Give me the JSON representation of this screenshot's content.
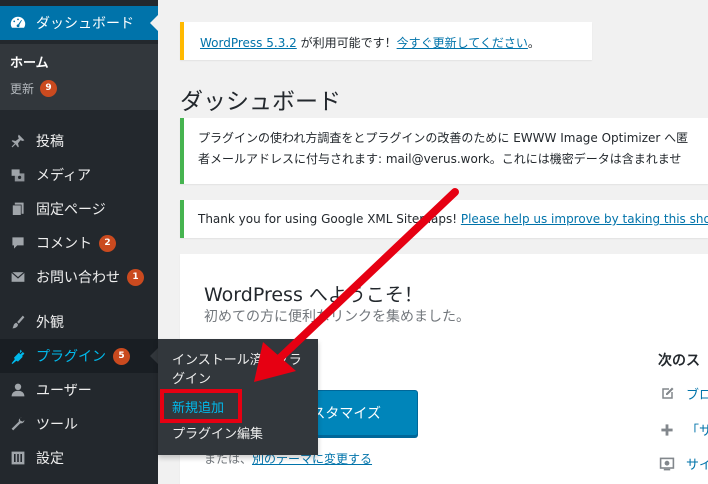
{
  "sidebar": {
    "dashboard": {
      "label": "ダッシュボード"
    },
    "dash_sub": {
      "home": "ホーム",
      "updates": "更新",
      "updates_count": "9"
    },
    "items": [
      {
        "id": "posts",
        "label": "投稿",
        "icon": "pin-icon"
      },
      {
        "id": "media",
        "label": "メディア",
        "icon": "media-icon"
      },
      {
        "id": "pages",
        "label": "固定ページ",
        "icon": "page-icon"
      },
      {
        "id": "comments",
        "label": "コメント",
        "icon": "comment-icon",
        "badge": "2"
      },
      {
        "id": "contact",
        "label": "お問い合わせ",
        "icon": "mail-icon",
        "badge": "1"
      },
      {
        "id": "appearance",
        "label": "外観",
        "icon": "brush-icon"
      },
      {
        "id": "plugins",
        "label": "プラグイン",
        "icon": "plugin-icon",
        "badge": "5"
      },
      {
        "id": "users",
        "label": "ユーザー",
        "icon": "user-icon"
      },
      {
        "id": "tools",
        "label": "ツール",
        "icon": "wrench-icon"
      },
      {
        "id": "settings",
        "label": "設定",
        "icon": "settings-icon"
      }
    ],
    "plugins_flyout": {
      "installed_line1": "インストール済みプラ",
      "installed_line2": "グイン",
      "add_new": "新規追加",
      "editor": "プラグイン編集"
    }
  },
  "notices": {
    "update_link": "WordPress 5.3.2",
    "update_text": " が利用可能です！",
    "update_now": "今すぐ更新してください",
    "update_end": "。",
    "ewww_line1": "プラグインの使われ方調査をとプラグインの改善のために EWWW Image Optimizer へ匿",
    "ewww_line2": "者メールアドレスに付与されます: mail@verus.work。これには機密データは含まれませ",
    "sitemaps_text": "Thank you for using Google XML Sitemaps! ",
    "sitemaps_link": "Please help us improve by taking this short"
  },
  "page": {
    "title": "ダッシュボード"
  },
  "welcome": {
    "title": "WordPress へようこそ！",
    "subtitle": "初めての方に便利なリンクを集めました。",
    "customize_button": "スタマイズ",
    "alt_prefix": "または、",
    "alt_link": "別のテーマに変更する",
    "next_title": "次のス",
    "next_items": [
      "ブロ",
      "「サ",
      "サイ"
    ]
  },
  "colors": {
    "sidebar": "#23282d",
    "accent": "#0073aa",
    "highlight": "#e60012",
    "badge": "#ca4a1f"
  }
}
